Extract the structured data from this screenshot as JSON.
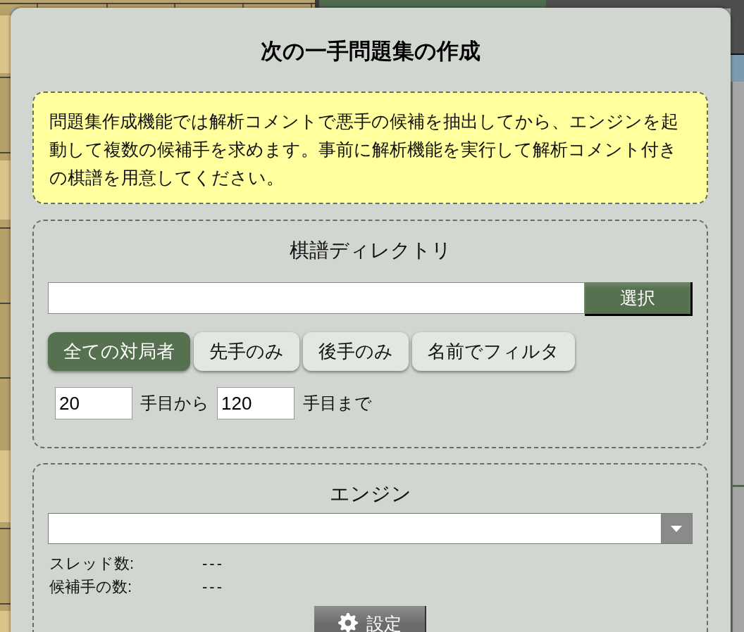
{
  "dialog": {
    "title": "次の一手問題集の作成"
  },
  "note": {
    "text": "問題集作成機能では解析コメントで悪手の候補を抽出してから、エンジンを起動して複数の候補手を求めます。事前に解析機能を実行して解析コメント付きの棋譜を用意してください。"
  },
  "kifu_directory": {
    "title": "棋譜ディレクトリ",
    "select_button": "選択",
    "filters": [
      {
        "label": "全ての対局者",
        "selected": true
      },
      {
        "label": "先手のみ",
        "selected": false
      },
      {
        "label": "後手のみ",
        "selected": false
      },
      {
        "label": "名前でフィルタ",
        "selected": false
      }
    ],
    "range": {
      "from_value": "20",
      "from_label": "手目から",
      "to_value": "120",
      "to_label": "手目まで"
    }
  },
  "engine": {
    "title": "エンジン",
    "stats": [
      {
        "label": "スレッド数:",
        "value": "---"
      },
      {
        "label": "候補手の数:",
        "value": "---"
      }
    ],
    "settings_button": "設定"
  }
}
